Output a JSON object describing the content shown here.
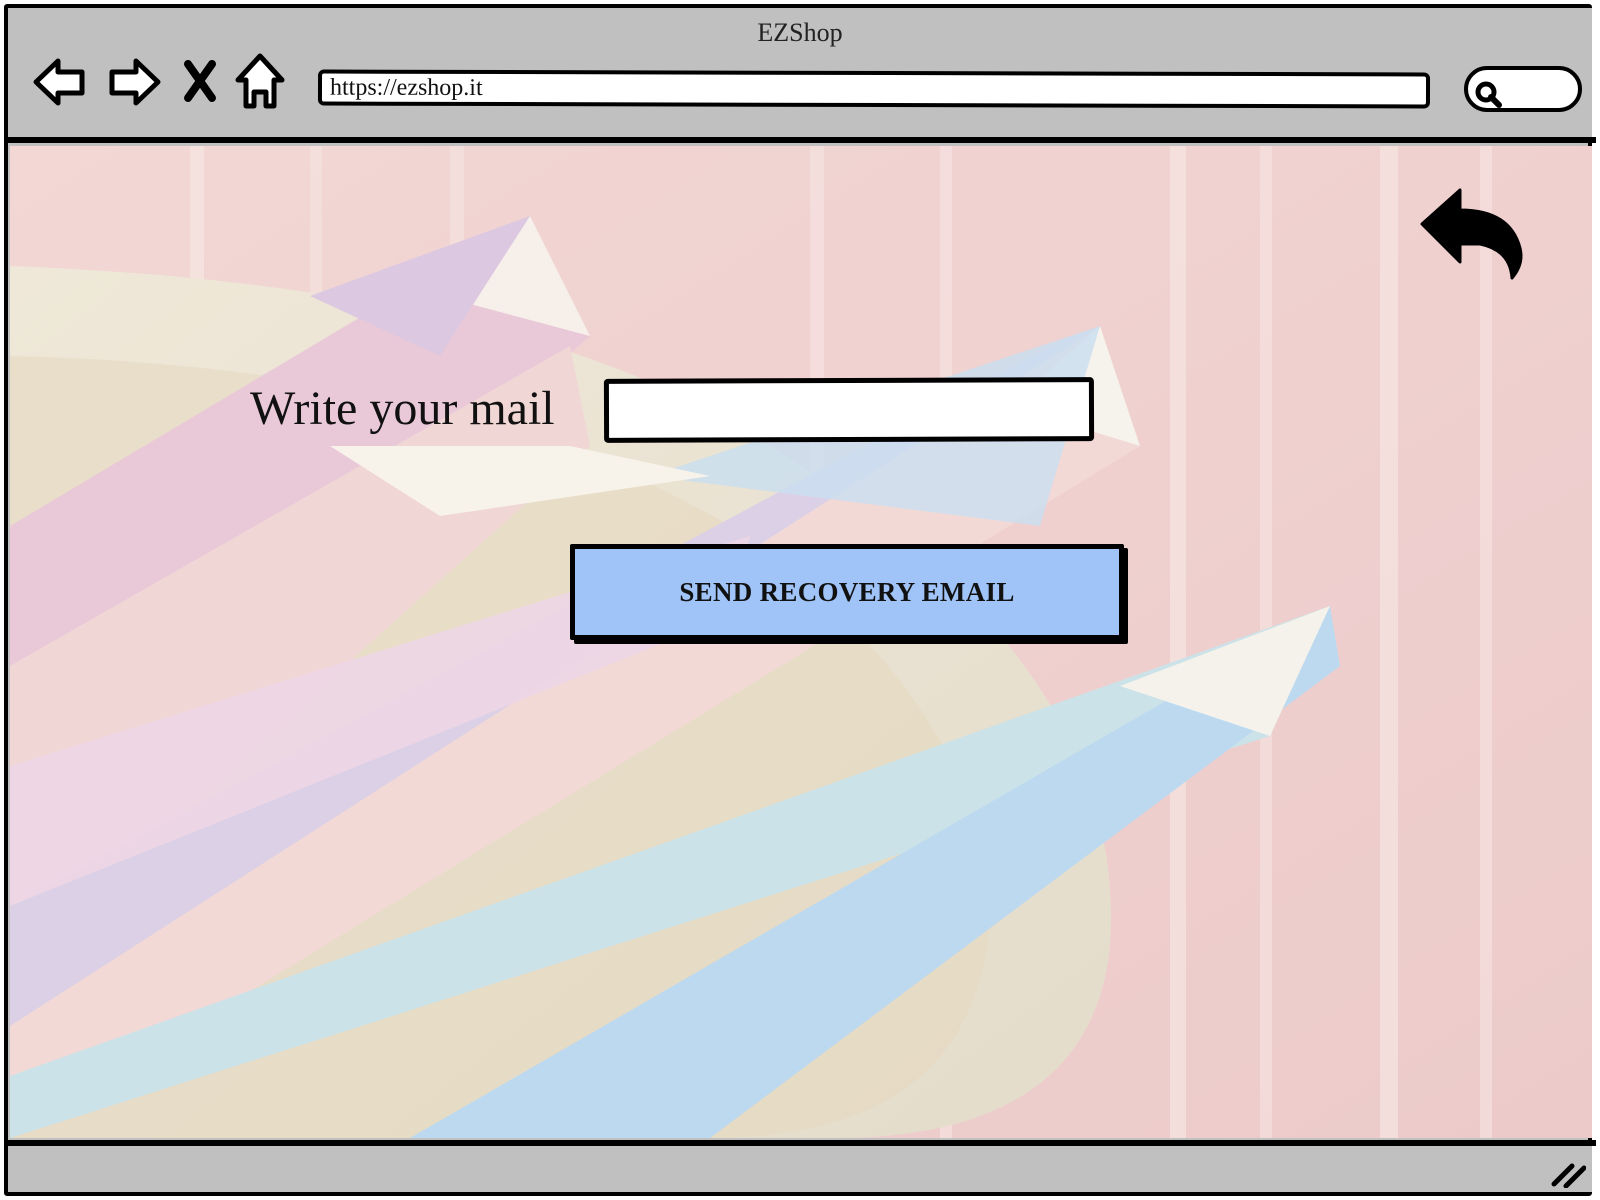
{
  "window": {
    "title": "EZShop"
  },
  "toolbar": {
    "icons": [
      "back-icon",
      "forward-icon",
      "stop-icon",
      "home-icon"
    ],
    "url": "https://ezshop.it",
    "search_icon": "search-icon"
  },
  "page": {
    "back_icon": "undo-arrow-icon",
    "mail_label": "Write your mail",
    "mail_value": "",
    "send_button_label": "SEND RECOVERY EMAIL",
    "button_color": "#a0c4f8"
  },
  "colors": {
    "chrome": "#c0c0c0",
    "background": "#f0cfcf",
    "stroke": "#000000"
  }
}
